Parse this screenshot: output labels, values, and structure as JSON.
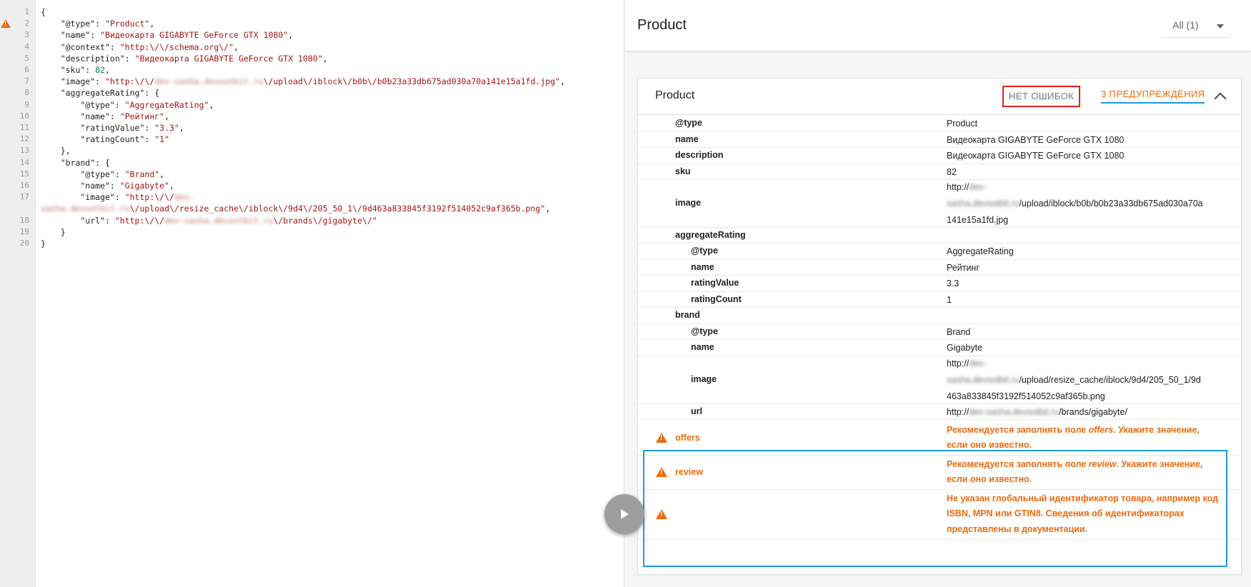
{
  "editor": {
    "lines": [
      {
        "n": "1",
        "segs": [
          {
            "t": "{",
            "c": "k"
          }
        ]
      },
      {
        "n": "2",
        "warn": true,
        "segs": [
          {
            "t": "    \"@type\": ",
            "c": "k"
          },
          {
            "t": "\"Product\"",
            "c": "s"
          },
          {
            "t": ",",
            "c": "k"
          }
        ]
      },
      {
        "n": "3",
        "segs": [
          {
            "t": "    \"name\": ",
            "c": "k"
          },
          {
            "t": "\"Видеокарта GIGABYTE GeForce GTX 1080\"",
            "c": "s"
          },
          {
            "t": ",",
            "c": "k"
          }
        ]
      },
      {
        "n": "4",
        "segs": [
          {
            "t": "    \"@context\": ",
            "c": "k"
          },
          {
            "t": "\"http:\\/\\/schema.org\\/\"",
            "c": "s"
          },
          {
            "t": ",",
            "c": "k"
          }
        ]
      },
      {
        "n": "5",
        "segs": [
          {
            "t": "    \"description\": ",
            "c": "k"
          },
          {
            "t": "\"Видеокарта GIGABYTE GeForce GTX 1080\"",
            "c": "s"
          },
          {
            "t": ",",
            "c": "k"
          }
        ]
      },
      {
        "n": "6",
        "segs": [
          {
            "t": "    \"sku\": ",
            "c": "k"
          },
          {
            "t": "82",
            "c": "n"
          },
          {
            "t": ",",
            "c": "k"
          }
        ]
      },
      {
        "n": "7",
        "segs": [
          {
            "t": "    \"image\": ",
            "c": "k"
          },
          {
            "t": "\"http:\\/\\/",
            "c": "s"
          },
          {
            "t": "dev-sasha.devsotbit.ru",
            "c": "blur"
          },
          {
            "t": "\\/upload\\/iblock\\/b0b\\/b0b23a33db675ad030a70a141e15a1fd.jpg\"",
            "c": "s"
          },
          {
            "t": ",",
            "c": "k"
          }
        ]
      },
      {
        "n": "8",
        "segs": [
          {
            "t": "    \"aggregateRating\": {",
            "c": "k"
          }
        ]
      },
      {
        "n": "9",
        "segs": [
          {
            "t": "        \"@type\": ",
            "c": "k"
          },
          {
            "t": "\"AggregateRating\"",
            "c": "s"
          },
          {
            "t": ",",
            "c": "k"
          }
        ]
      },
      {
        "n": "10",
        "segs": [
          {
            "t": "        \"name\": ",
            "c": "k"
          },
          {
            "t": "\"Рейтинг\"",
            "c": "s"
          },
          {
            "t": ",",
            "c": "k"
          }
        ]
      },
      {
        "n": "11",
        "segs": [
          {
            "t": "        \"ratingValue\": ",
            "c": "k"
          },
          {
            "t": "\"3.3\"",
            "c": "s"
          },
          {
            "t": ",",
            "c": "k"
          }
        ]
      },
      {
        "n": "12",
        "segs": [
          {
            "t": "        \"ratingCount\": ",
            "c": "k"
          },
          {
            "t": "\"1\"",
            "c": "s"
          }
        ]
      },
      {
        "n": "13",
        "segs": [
          {
            "t": "    },",
            "c": "k"
          }
        ]
      },
      {
        "n": "14",
        "segs": [
          {
            "t": "    \"brand\": {",
            "c": "k"
          }
        ]
      },
      {
        "n": "15",
        "segs": [
          {
            "t": "        \"@type\": ",
            "c": "k"
          },
          {
            "t": "\"Brand\"",
            "c": "s"
          },
          {
            "t": ",",
            "c": "k"
          }
        ]
      },
      {
        "n": "16",
        "segs": [
          {
            "t": "        \"name\": ",
            "c": "k"
          },
          {
            "t": "\"Gigabyte\"",
            "c": "s"
          },
          {
            "t": ",",
            "c": "k"
          }
        ]
      },
      {
        "n": "17",
        "segs": [
          {
            "t": "        \"image\": ",
            "c": "k"
          },
          {
            "t": "\"http:\\/\\/",
            "c": "s"
          },
          {
            "t": "dev-",
            "c": "blur"
          }
        ]
      },
      {
        "n": "",
        "segs": [
          {
            "t": "sasha.devsotbit.ru",
            "c": "blur"
          },
          {
            "t": "\\/upload\\/resize_cache\\/iblock\\/9d4\\/205_50_1\\/9d463a833845f3192f514052c9af365b.png\"",
            "c": "s"
          },
          {
            "t": ",",
            "c": "k"
          }
        ]
      },
      {
        "n": "18",
        "segs": [
          {
            "t": "        \"url\": ",
            "c": "k"
          },
          {
            "t": "\"http:\\/\\/",
            "c": "s"
          },
          {
            "t": "dev-sasha.devsotbit.ru",
            "c": "blur"
          },
          {
            "t": "\\/brands\\/gigabyte\\/\"",
            "c": "s"
          }
        ]
      },
      {
        "n": "19",
        "segs": [
          {
            "t": "    }",
            "c": "k"
          }
        ]
      },
      {
        "n": "20",
        "segs": [
          {
            "t": "}",
            "c": "k"
          }
        ]
      }
    ]
  },
  "panel": {
    "title": "Product",
    "filter_label": "All (1)"
  },
  "card": {
    "title": "Product",
    "errors_label": "НЕТ ОШИБОК",
    "warnings_label": "3 ПРЕДУПРЕЖДЕНИЯ",
    "rows": [
      {
        "prop": "@type",
        "indent": 0,
        "h": 23,
        "val": [
          {
            "t": "Product"
          }
        ]
      },
      {
        "prop": "name",
        "indent": 0,
        "h": 22,
        "val": [
          {
            "t": "Видеокарта GIGABYTE GeForce GTX 1080"
          }
        ]
      },
      {
        "prop": "description",
        "indent": 0,
        "h": 23,
        "val": [
          {
            "t": "Видеокарта GIGABYTE GeForce GTX 1080"
          }
        ]
      },
      {
        "prop": "sku",
        "indent": 0,
        "h": 22,
        "val": [
          {
            "t": "82"
          }
        ]
      },
      {
        "prop": "image",
        "indent": 0,
        "h": 67,
        "val": [
          {
            "t": "http://"
          },
          {
            "t": "dev-",
            "blur": true
          },
          {
            "br": true
          },
          {
            "t": "sasha.devsotbit.ru",
            "blur": true
          },
          {
            "t": "/upload/iblock/b0b/b0b23a33db675ad030a70a"
          },
          {
            "br": true
          },
          {
            "t": "141e15a1fd.jpg"
          }
        ]
      },
      {
        "prop": "aggregateRating",
        "indent": 0,
        "h": 22,
        "val": []
      },
      {
        "prop": "@type",
        "indent": 1,
        "h": 23,
        "val": [
          {
            "t": "AggregateRating"
          }
        ]
      },
      {
        "prop": "name",
        "indent": 1,
        "h": 22,
        "val": [
          {
            "t": "Рейтинг"
          }
        ]
      },
      {
        "prop": "ratingValue",
        "indent": 1,
        "h": 23,
        "val": [
          {
            "t": "3.3"
          }
        ]
      },
      {
        "prop": "ratingCount",
        "indent": 1,
        "h": 22,
        "val": [
          {
            "t": "1"
          }
        ]
      },
      {
        "prop": "brand",
        "indent": 0,
        "h": 23,
        "val": []
      },
      {
        "prop": "@type",
        "indent": 1,
        "h": 22,
        "val": [
          {
            "t": "Brand"
          }
        ]
      },
      {
        "prop": "name",
        "indent": 1,
        "h": 23,
        "val": [
          {
            "t": "Gigabyte"
          }
        ]
      },
      {
        "prop": "image",
        "indent": 1,
        "h": 67,
        "val": [
          {
            "t": "http://"
          },
          {
            "t": "dev-",
            "blur": true
          },
          {
            "br": true
          },
          {
            "t": "sasha.devsotbit.ru",
            "blur": true
          },
          {
            "t": "/upload/resize_cache/iblock/9d4/205_50_1/9d"
          },
          {
            "br": true
          },
          {
            "t": "463a833845f3192f514052c9af365b.png"
          }
        ]
      },
      {
        "prop": "url",
        "indent": 1,
        "h": 22,
        "val": [
          {
            "t": "http://"
          },
          {
            "t": "dev-sasha.devsotbit.ru",
            "blur": true
          },
          {
            "t": "/brands/gigabyte/"
          }
        ]
      }
    ],
    "warnings": [
      {
        "prop": "offers",
        "h": 48,
        "val": [
          {
            "t": "Рекомендуется заполнять поле "
          },
          {
            "t": "offers",
            "i": true
          },
          {
            "t": ". Укажите значение,"
          },
          {
            "br": true
          },
          {
            "t": "если оно известно."
          }
        ]
      },
      {
        "prop": "review",
        "h": 48,
        "val": [
          {
            "t": "Рекомендуется заполнять поле "
          },
          {
            "t": "review",
            "i": true
          },
          {
            "t": ". Укажите значение,"
          },
          {
            "br": true
          },
          {
            "t": "если оно известно."
          }
        ]
      },
      {
        "prop": "",
        "h": 70,
        "val": [
          {
            "t": "Не указан глобальный идентификатор товара, например код"
          },
          {
            "br": true
          },
          {
            "t": "ISBN, MPN или GTIN8. Сведения об идентификаторах"
          },
          {
            "br": true
          },
          {
            "t": "представлены в документации."
          }
        ]
      }
    ]
  },
  "colors": {
    "warning": "#ea6a10",
    "highlight_blue": "#1a9be0",
    "highlight_red": "#e01e1e"
  }
}
